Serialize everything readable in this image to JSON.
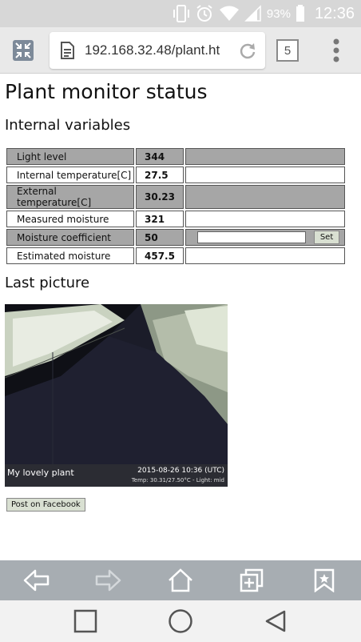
{
  "status_bar": {
    "battery": "93%",
    "time": "12:36"
  },
  "browser": {
    "url": "192.168.32.48/plant.ht",
    "tab_count": "5"
  },
  "page": {
    "title": "Plant monitor status",
    "section_variables": "Internal variables",
    "rows": [
      {
        "label": "Light level",
        "value": "344"
      },
      {
        "label": "Internal temperature[C]",
        "value": "27.5"
      },
      {
        "label": "External temperature[C]",
        "value": "30.23"
      },
      {
        "label": "Measured moisture",
        "value": "321"
      },
      {
        "label": "Moisture coefficient",
        "value": "50"
      },
      {
        "label": "Estimated moisture",
        "value": "457.5"
      }
    ],
    "set_button": "Set",
    "section_picture": "Last picture",
    "picture_caption": "My lovely plant",
    "picture_timestamp": "2015-08-26 10:36 (UTC)",
    "picture_info": "Temp: 30.31/27.50°C - Light: mid",
    "facebook_button": "Post on Facebook"
  },
  "colors": {
    "status_bar": "#d7d7d7",
    "toolbar": "#e9e9e9",
    "shaded_row": "#a6a6a6",
    "bottom_bar": "#a7adb2"
  }
}
